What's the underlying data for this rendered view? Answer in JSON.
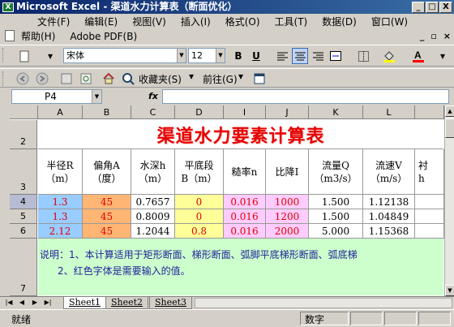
{
  "app": {
    "title": "Microsoft Excel - 渠道水力计算表（断面优化）",
    "icon": "excel-app-icon",
    "window_buttons": [
      "_",
      "□",
      "X"
    ]
  },
  "menu": {
    "row1": [
      "文件(F)",
      "编辑(E)",
      "视图(V)",
      "插入(I)",
      "格式(O)",
      "工具(T)",
      "数据(D)",
      "窗口(W)"
    ],
    "row2": [
      "帮助(H)",
      "Adobe PDF(B)"
    ],
    "doc_buttons": [
      "_",
      "▫",
      "×"
    ]
  },
  "toolbar": {
    "font_name": "宋体",
    "font_size": "12",
    "bold": "B",
    "underline": "U",
    "favorites": "收藏夹(S)",
    "goto": "前往(G)"
  },
  "formula_bar": {
    "cell_ref": "P4",
    "fx": "fx",
    "content": ""
  },
  "columns": [
    "A",
    "B",
    "C",
    "D",
    "I",
    "J",
    "K",
    "L"
  ],
  "rows": [
    "2",
    "3",
    "4",
    "5",
    "6",
    "7"
  ],
  "sheet_title": "渠道水力要素计算表",
  "headers": [
    [
      "半径R",
      "（m）"
    ],
    [
      "偏角A",
      "（度）"
    ],
    [
      "水深h",
      "（m）"
    ],
    [
      "平底段",
      "B（m）"
    ],
    [
      "糙率n",
      ""
    ],
    [
      "比降I",
      ""
    ],
    [
      "流量Q",
      "（m3/s）"
    ],
    [
      "流速V",
      "（m/s）"
    ],
    [
      "衬",
      "h"
    ]
  ],
  "data_rows": [
    {
      "r": "1.3",
      "a": "45",
      "h": "0.7657",
      "b": "0",
      "n": "0.016",
      "i": "1000",
      "q": "1.500",
      "v": "1.12138"
    },
    {
      "r": "1.3",
      "a": "45",
      "h": "0.8009",
      "b": "0",
      "n": "0.016",
      "i": "1200",
      "q": "1.500",
      "v": "1.04849"
    },
    {
      "r": "2.12",
      "a": "45",
      "h": "1.2044",
      "b": "0.8",
      "n": "0.016",
      "i": "2000",
      "q": "5.000",
      "v": "1.15368"
    }
  ],
  "note": {
    "line1": "说明：1、本计算适用于矩形断面、梯形断面、弧脚平底梯形断面、弧底梯",
    "line2": "2、红色字体是需要输入的值。"
  },
  "tabs": [
    "Sheet1",
    "Sheet2",
    "Sheet3"
  ],
  "status": {
    "left": "就绪",
    "mid": "数字"
  },
  "colors": {
    "input_blue": "#99ccff",
    "input_orange": "#ffb573",
    "input_yellow": "#ffff99",
    "input_pink": "#ffccff",
    "note_green": "#ccffcc",
    "title_red": "#e60000"
  }
}
